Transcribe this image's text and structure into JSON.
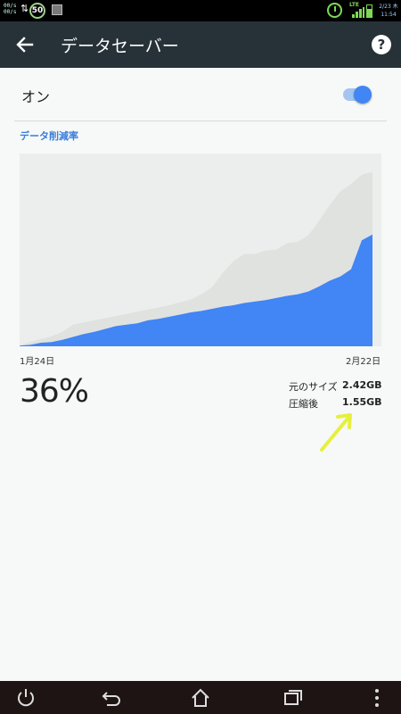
{
  "status_bar": {
    "speed_up": "00/s",
    "speed_down": "00/s",
    "sync_badge": "50",
    "network_type": "LTE",
    "date": "2/23 木",
    "time": "11:54"
  },
  "app_bar": {
    "title": "データセーバー"
  },
  "toggle": {
    "label": "オン",
    "state": "on",
    "color": "#4285f4"
  },
  "section": {
    "title": "データ削減率"
  },
  "chart_data": {
    "type": "area",
    "x_start_label": "1月24日",
    "x_end_label": "2月22日",
    "series": [
      {
        "name": "元のサイズ",
        "color": "#e0e2e0",
        "values": [
          0.01,
          0.06,
          0.1,
          0.14,
          0.2,
          0.3,
          0.33,
          0.36,
          0.39,
          0.42,
          0.45,
          0.48,
          0.51,
          0.54,
          0.57,
          0.61,
          0.65,
          0.72,
          0.82,
          1.02,
          1.18,
          1.28,
          1.28,
          1.33,
          1.34,
          1.43,
          1.45,
          1.54,
          1.74,
          1.96,
          2.15,
          2.25,
          2.38,
          2.42
        ]
      },
      {
        "name": "圧縮後",
        "color": "#4285f4",
        "values": [
          0.01,
          0.02,
          0.05,
          0.06,
          0.09,
          0.13,
          0.17,
          0.2,
          0.24,
          0.28,
          0.3,
          0.32,
          0.36,
          0.38,
          0.41,
          0.44,
          0.47,
          0.49,
          0.52,
          0.55,
          0.57,
          0.6,
          0.62,
          0.64,
          0.67,
          0.7,
          0.72,
          0.76,
          0.83,
          0.91,
          0.97,
          1.07,
          1.47,
          1.55
        ]
      }
    ],
    "y_max": 2.6,
    "unit": "GB",
    "grid": false,
    "legend": "none"
  },
  "stats": {
    "percent": "36%",
    "original_label": "元のサイズ",
    "original_value": "2.42GB",
    "compressed_label": "圧縮後",
    "compressed_value": "1.55GB"
  },
  "annotation": {
    "arrow_color": "#e6f03c"
  },
  "nav_bar": {
    "icons": [
      "power-icon",
      "back-icon",
      "home-icon",
      "recents-icon",
      "menu-icon"
    ]
  }
}
